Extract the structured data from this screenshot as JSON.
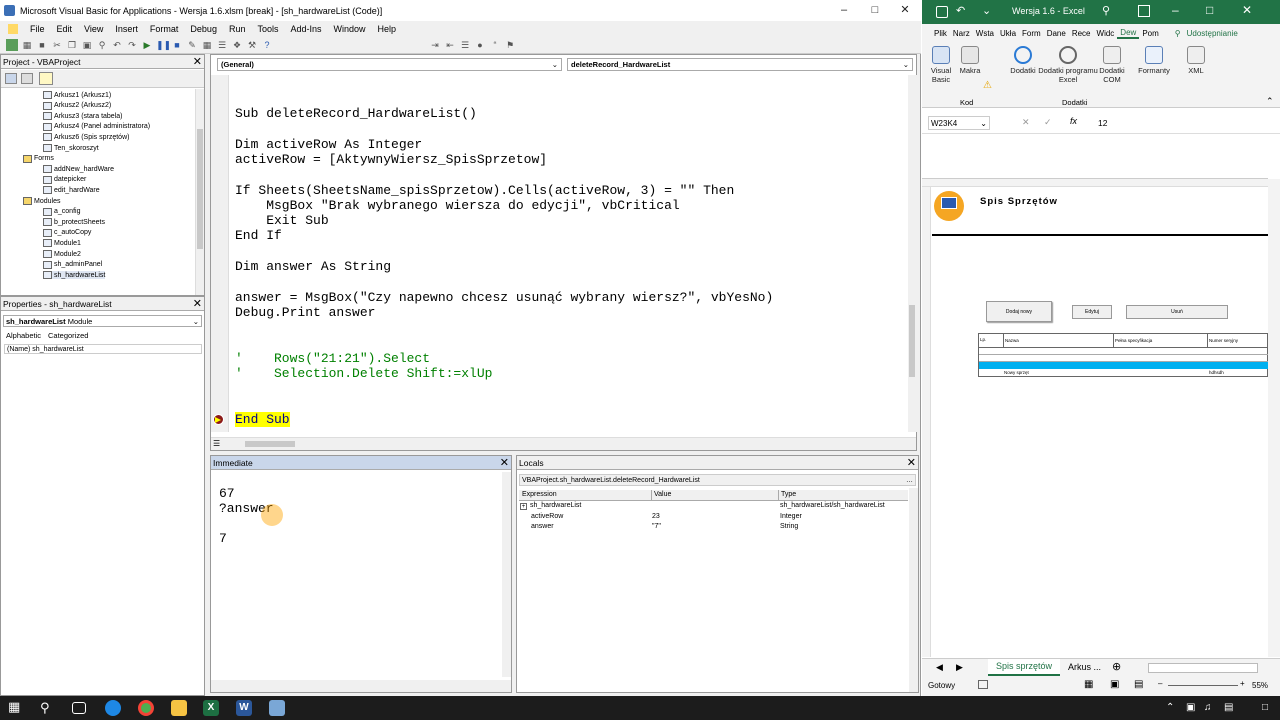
{
  "vbe": {
    "title": "Microsoft Visual Basic for Applications - Wersja 1.6.xlsm [break] - [sh_hardwareList (Code)]",
    "menu": [
      "File",
      "Edit",
      "View",
      "Insert",
      "Format",
      "Debug",
      "Run",
      "Tools",
      "Add-Ins",
      "Window",
      "Help"
    ]
  },
  "project": {
    "title": "Project - VBAProject",
    "items": [
      {
        "label": "Arkusz1 (Arkusz1)",
        "indent": 3
      },
      {
        "label": "Arkusz2 (Arkusz2)",
        "indent": 3
      },
      {
        "label": "Arkusz3 (stara tabela)",
        "indent": 3
      },
      {
        "label": "Arkusz4 (Panel administratora)",
        "indent": 3
      },
      {
        "label": "Arkusz6 (Spis sprzętów)",
        "indent": 3
      },
      {
        "label": "Ten_skoroszyt",
        "indent": 3
      },
      {
        "label": "Forms",
        "indent": 2
      },
      {
        "label": "addNew_hardWare",
        "indent": 3
      },
      {
        "label": "datepicker",
        "indent": 3
      },
      {
        "label": "edit_hardWare",
        "indent": 3
      },
      {
        "label": "Modules",
        "indent": 2
      },
      {
        "label": "a_config",
        "indent": 3
      },
      {
        "label": "b_protectSheets",
        "indent": 3
      },
      {
        "label": "c_autoCopy",
        "indent": 3
      },
      {
        "label": "Module1",
        "indent": 3
      },
      {
        "label": "Module2",
        "indent": 3
      },
      {
        "label": "sh_adminPanel",
        "indent": 3
      },
      {
        "label": "sh_hardwareList",
        "indent": 3
      }
    ]
  },
  "properties": {
    "title": "Properties - sh_hardwareList",
    "object": "sh_hardwareList",
    "object_type": "Module",
    "tab_alpha": "Alphabetic",
    "tab_cat": "Categorized",
    "row_name": "(Name)",
    "row_value": "sh_hardwareList"
  },
  "code": {
    "combo_left": "(General)",
    "combo_right": "deleteRecord_HardwareList",
    "lines": [
      "Sub deleteRecord_HardwareList()",
      "",
      "Dim activeRow As Integer",
      "activeRow = [AktywnyWiersz_SpisSprzetow]",
      "",
      "If Sheets(SheetsName_spisSprzetow).Cells(activeRow, 3) = \"\" Then",
      "    MsgBox \"Brak wybranego wiersza do edycji\", vbCritical",
      "    Exit Sub",
      "End If",
      "",
      "Dim answer As String",
      "",
      "answer = MsgBox(\"Czy napewno chcesz usunąć wybrany wiersz?\", vbYesNo)",
      "Debug.Print answer",
      "",
      "",
      "'    Rows(\"21:21\").Select",
      "'    Selection.Delete Shift:=xlUp",
      "",
      "",
      "End Sub"
    ]
  },
  "immediate": {
    "title": "Immediate",
    "lines": [
      "67",
      "?answer",
      "",
      "7"
    ]
  },
  "locals": {
    "title": "Locals",
    "context": "VBAProject.sh_hardwareList.deleteRecord_HardwareList",
    "headers": [
      "Expression",
      "Value",
      "Type"
    ],
    "rows": [
      {
        "expr": "sh_hardwareList",
        "value": "",
        "type": "sh_hardwareList/sh_hardwareList"
      },
      {
        "expr": "activeRow",
        "value": "23",
        "type": "Integer"
      },
      {
        "expr": "answer",
        "value": "\"7\"",
        "type": "String"
      }
    ]
  },
  "excel": {
    "title": "Wersja 1.6 - Excel",
    "tabs": [
      "Plik",
      "Narz",
      "Wsta",
      "Ukła",
      "Form",
      "Dane",
      "Rece",
      "Widc",
      "Dew",
      "Pom"
    ],
    "share": "Udostępnianie",
    "ribbon": [
      {
        "label": "Visual Basic"
      },
      {
        "label": "Makra"
      },
      {
        "label": "Dodatki"
      },
      {
        "label": "Dodatki programu Excel"
      },
      {
        "label": "Dodatki COM"
      },
      {
        "label": "Formanty"
      },
      {
        "label": "XML"
      }
    ],
    "group_kod": "Kod",
    "group_dodatki": "Dodatki",
    "name_box": "W23K4",
    "formula_value": "12",
    "sheet_title": "Spis Sprzętów",
    "buttons": [
      "Dodaj nowy",
      "Edytuj",
      "Usuń"
    ],
    "table_headers": [
      "Lp.",
      "Nazwa",
      "Pełna specyfikacja",
      "Numer seryjny"
    ],
    "table_row": [
      "Nowy sprzęt",
      "hdhsdh"
    ],
    "sheet_tabs": [
      "Spis sprzętów",
      "Arkus ..."
    ],
    "status": "Gotowy",
    "zoom": "55%"
  },
  "colors": {
    "accent": "#217346",
    "highlight": "#ffff00",
    "keyword": "#00008b",
    "comment": "#008000",
    "selection": "#00b0f0"
  }
}
